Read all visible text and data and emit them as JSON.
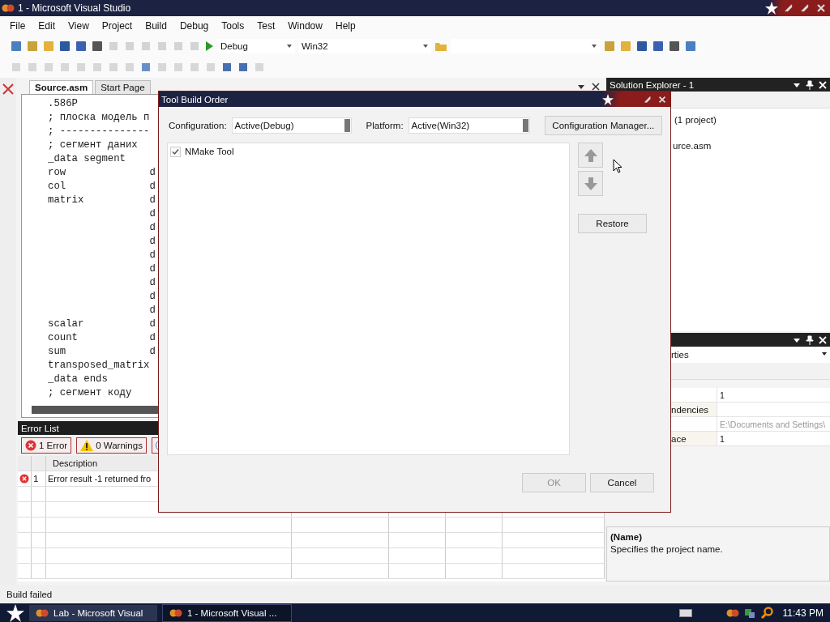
{
  "window": {
    "title": "1 - Microsoft Visual Studio"
  },
  "menu": [
    "File",
    "Edit",
    "View",
    "Project",
    "Build",
    "Debug",
    "Tools",
    "Test",
    "Window",
    "Help"
  ],
  "toolbar": {
    "configuration": "Debug",
    "platform": "Win32"
  },
  "editor": {
    "tabs": [
      {
        "label": "Source.asm",
        "selected": true
      },
      {
        "label": "Start Page",
        "selected": false
      }
    ],
    "lines": [
      ".586P",
      "; плоска модель п",
      "; ---------------",
      "; сегмент даних",
      "_data segment",
      "row              d",
      "col              d",
      "matrix           d",
      "                 d",
      "                 d",
      "                 d",
      "                 d",
      "                 d",
      "                 d",
      "                 d",
      "                 d",
      "scalar           d",
      "count            d",
      "sum              d",
      "transposed_matrix",
      "_data ends",
      "; сегмент коду"
    ]
  },
  "error_list": {
    "title": "Error List",
    "filters": [
      {
        "kind": "error",
        "label": "1 Error"
      },
      {
        "kind": "warning",
        "label": "0 Warnings"
      },
      {
        "kind": "info"
      }
    ],
    "column": "Description",
    "rows": [
      {
        "kind": "error",
        "number": "1",
        "description": "Error result -1 returned fro"
      }
    ]
  },
  "solution_explorer": {
    "title": "Solution Explorer - 1",
    "items": [
      "(1 project)",
      "urce.asm"
    ]
  },
  "properties": {
    "dropdown": "rties",
    "rows": [
      {
        "value": "1"
      },
      {
        "name": "ndencies"
      },
      {
        "value": "E:\\Documents and Settings\\",
        "disabled": true
      },
      {
        "name": "ace",
        "value": "1"
      }
    ],
    "description_title": "(Name)",
    "description": "Specifies the project name."
  },
  "status_bar": "Build failed",
  "taskbar": {
    "tasks": [
      {
        "label": "Lab - Microsoft Visual",
        "selected": false
      },
      {
        "label": "1 - Microsoft Visual ...",
        "selected": true
      }
    ],
    "clock": "11:43 PM"
  },
  "dialog": {
    "title": "Tool Build Order",
    "configuration_label": "Configuration:",
    "configuration": "Active(Debug)",
    "platform_label": "Platform:",
    "platform": "Active(Win32)",
    "manager_button": "Configuration Manager...",
    "tools": [
      {
        "label": "NMake Tool",
        "checked": true
      }
    ],
    "restore_button": "Restore",
    "ok_button": {
      "label": "OK",
      "disabled": true
    },
    "cancel_button": "Cancel"
  }
}
